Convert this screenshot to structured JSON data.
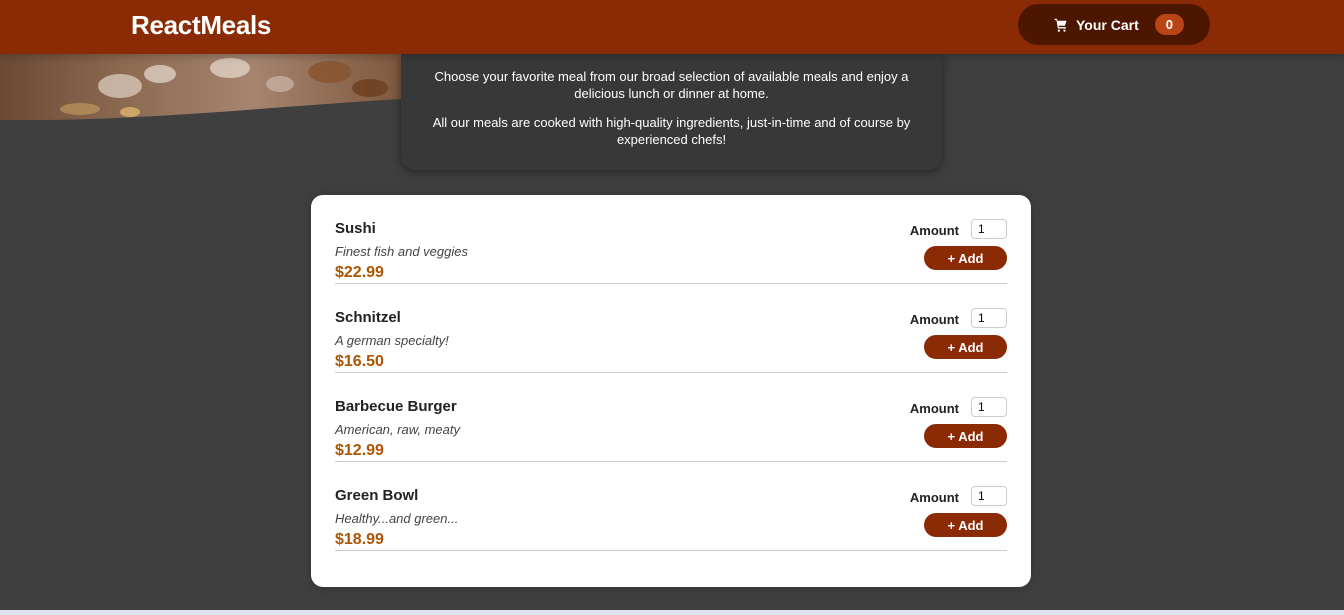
{
  "header": {
    "brand": "ReactMeals",
    "cart_label": "Your Cart",
    "cart_count": "0",
    "cart_icon": "cart-icon"
  },
  "summary": {
    "paragraph1": "Choose your favorite meal from our broad selection of available meals and enjoy a delicious lunch or dinner at home.",
    "paragraph2": "All our meals are cooked with high-quality ingredients, just-in-time and of course by experienced chefs!"
  },
  "meals": [
    {
      "name": "Sushi",
      "description": "Finest fish and veggies",
      "price": "$22.99",
      "amount_label": "Amount",
      "amount_value": "1",
      "add_label": "+ Add"
    },
    {
      "name": "Schnitzel",
      "description": "A german specialty!",
      "price": "$16.50",
      "amount_label": "Amount",
      "amount_value": "1",
      "add_label": "+ Add"
    },
    {
      "name": "Barbecue Burger",
      "description": "American, raw, meaty",
      "price": "$12.99",
      "amount_label": "Amount",
      "amount_value": "1",
      "add_label": "+ Add"
    },
    {
      "name": "Green Bowl",
      "description": "Healthy...and green...",
      "price": "$18.99",
      "amount_label": "Amount",
      "amount_value": "1",
      "add_label": "+ Add"
    }
  ],
  "colors": {
    "header_bg": "#8a2b06",
    "cart_button_bg": "#4d1601",
    "badge_bg": "#b94517",
    "price": "#ad5502",
    "page_bg": "#3f3f3f"
  }
}
